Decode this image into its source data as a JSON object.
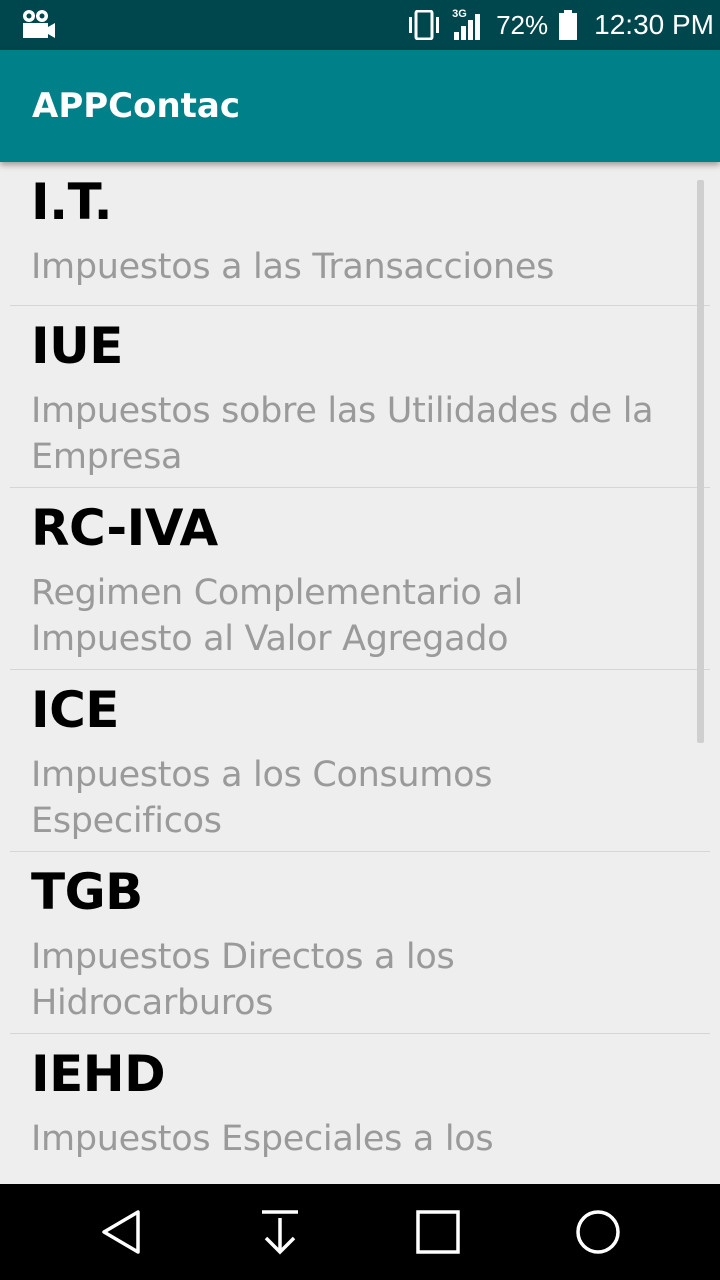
{
  "status_bar": {
    "left_icon": "video-camera-icon",
    "vibrate_icon": "vibrate-icon",
    "network_label": "3G",
    "signal_icon": "signal-icon",
    "battery_percent": "72%",
    "battery_icon": "battery-icon",
    "time": "12:30 PM"
  },
  "app_bar": {
    "title": "APPContac",
    "background": "#00818a"
  },
  "list": {
    "items": [
      {
        "title": "I.T.",
        "subtitle": "Impuestos a las Transacciones"
      },
      {
        "title": "IUE",
        "subtitle": "Impuestos sobre las Utilidades de la Empresa"
      },
      {
        "title": "RC-IVA",
        "subtitle": "Regimen Complementario al Impuesto al Valor Agregado"
      },
      {
        "title": "ICE",
        "subtitle": "Impuestos a los Consumos Especificos"
      },
      {
        "title": "TGB",
        "subtitle": "Impuestos Directos a los Hidrocarburos"
      },
      {
        "title": "IEHD",
        "subtitle": "Impuestos Especiales a los"
      }
    ]
  },
  "nav_bar": {
    "back_icon": "back-triangle-icon",
    "download_icon": "download-arrow-icon",
    "recents_icon": "square-recents-icon",
    "home_icon": "circle-home-icon"
  },
  "colors": {
    "status_bar": "#00464d",
    "app_bar": "#00818a",
    "list_background": "#eeeeee",
    "subtitle_text": "#9a9a9a"
  }
}
